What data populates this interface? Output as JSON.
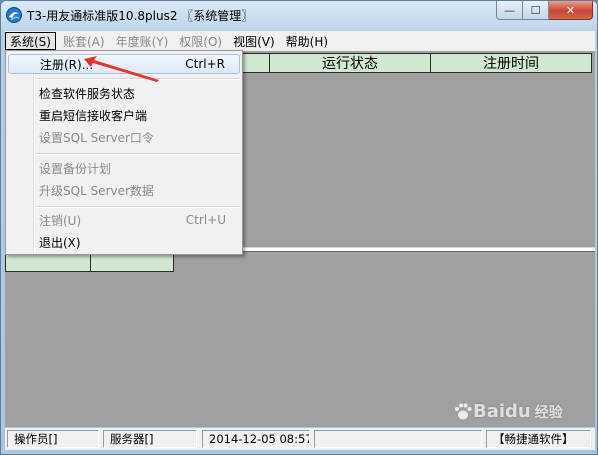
{
  "window": {
    "title": "T3-用友通标准版10.8plus2 〖系统管理〗",
    "minimize_glyph": "—",
    "maximize_glyph": "☐",
    "close_glyph": "✕"
  },
  "menubar": {
    "items": [
      {
        "label": "系统(S)",
        "enabled": true,
        "active": true
      },
      {
        "label": "账套(A)",
        "enabled": false
      },
      {
        "label": "年度账(Y)",
        "enabled": false
      },
      {
        "label": "权限(O)",
        "enabled": false
      },
      {
        "label": "视图(V)",
        "enabled": true
      },
      {
        "label": "帮助(H)",
        "enabled": true
      }
    ]
  },
  "system_menu": {
    "items": [
      {
        "label": "注册(R)...",
        "shortcut": "Ctrl+R",
        "enabled": true,
        "highlighted": true
      },
      {
        "label": "检查软件服务状态",
        "shortcut": "",
        "enabled": true
      },
      {
        "label": "重启短信接收客户端",
        "shortcut": "",
        "enabled": true
      },
      {
        "label": "设置SQL Server口令",
        "shortcut": "",
        "enabled": false
      },
      {
        "label": "设置备份计划",
        "shortcut": "",
        "enabled": false
      },
      {
        "label": "升级SQL Server数据",
        "shortcut": "",
        "enabled": false
      },
      {
        "label": "注销(U)",
        "shortcut": "Ctrl+U",
        "enabled": false
      },
      {
        "label": "退出(X)",
        "shortcut": "",
        "enabled": true
      }
    ]
  },
  "grid": {
    "columns": [
      "运行状态",
      "注册时间"
    ]
  },
  "statusbar": {
    "operator": "操作员[]",
    "server": "服务器[]",
    "datetime": "2014-12-05  08:57",
    "empty": "",
    "brand": "【畅捷通软件】"
  },
  "watermark": {
    "logo_text": "Baidu",
    "sub_text": "经验"
  },
  "colors": {
    "grid_header": "#cfe8cf",
    "client_bg": "#a0a0a0",
    "annotation_arrow": "#e8322b"
  }
}
